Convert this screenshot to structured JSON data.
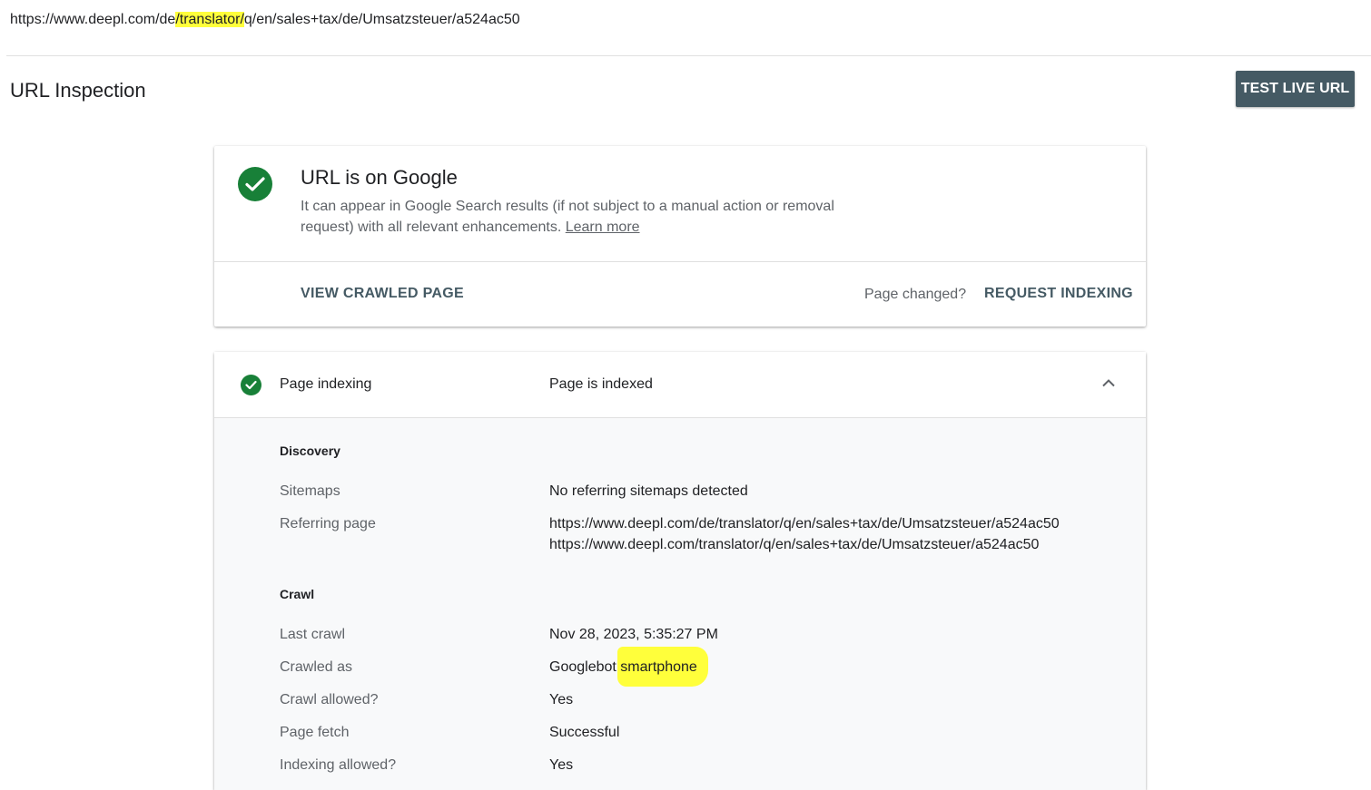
{
  "url_bar": {
    "prefix": "https://www.deepl.com/de",
    "highlight": "/translator/",
    "suffix": "q/en/sales+tax/de/Umsatzsteuer/a524ac50"
  },
  "header": {
    "title": "URL Inspection",
    "test_live_label": "TEST LIVE URL"
  },
  "status_card": {
    "title": "URL is on Google",
    "description": "It can appear in Google Search results (if not subject to a manual action or removal request) with all relevant enhancements.",
    "learn_more": "Learn more",
    "view_crawled_label": "VIEW CRAWLED PAGE",
    "page_changed": "Page changed?",
    "request_indexing_label": "REQUEST INDEXING"
  },
  "indexing": {
    "name": "Page indexing",
    "status": "Page is indexed",
    "discovery": {
      "title": "Discovery",
      "sitemaps_label": "Sitemaps",
      "sitemaps_value": "No referring sitemaps detected",
      "referring_label": "Referring page",
      "referring_values": [
        "https://www.deepl.com/de/translator/q/en/sales+tax/de/Umsatzsteuer/a524ac50",
        "https://www.deepl.com/translator/q/en/sales+tax/de/Umsatzsteuer/a524ac50"
      ]
    },
    "crawl": {
      "title": "Crawl",
      "last_crawl_label": "Last crawl",
      "last_crawl_value": "Nov 28, 2023, 5:35:27 PM",
      "crawled_as_label": "Crawled as",
      "crawled_as_prefix": "Googlebot",
      "crawled_as_highlight": "smartphone",
      "crawl_allowed_label": "Crawl allowed?",
      "crawl_allowed_value": "Yes",
      "page_fetch_label": "Page fetch",
      "page_fetch_value": "Successful",
      "indexing_allowed_label": "Indexing allowed?",
      "indexing_allowed_value": "Yes"
    }
  },
  "colors": {
    "success_green": "#188038",
    "button_slate": "#455a64",
    "highlight_yellow": "#ffff3b"
  }
}
